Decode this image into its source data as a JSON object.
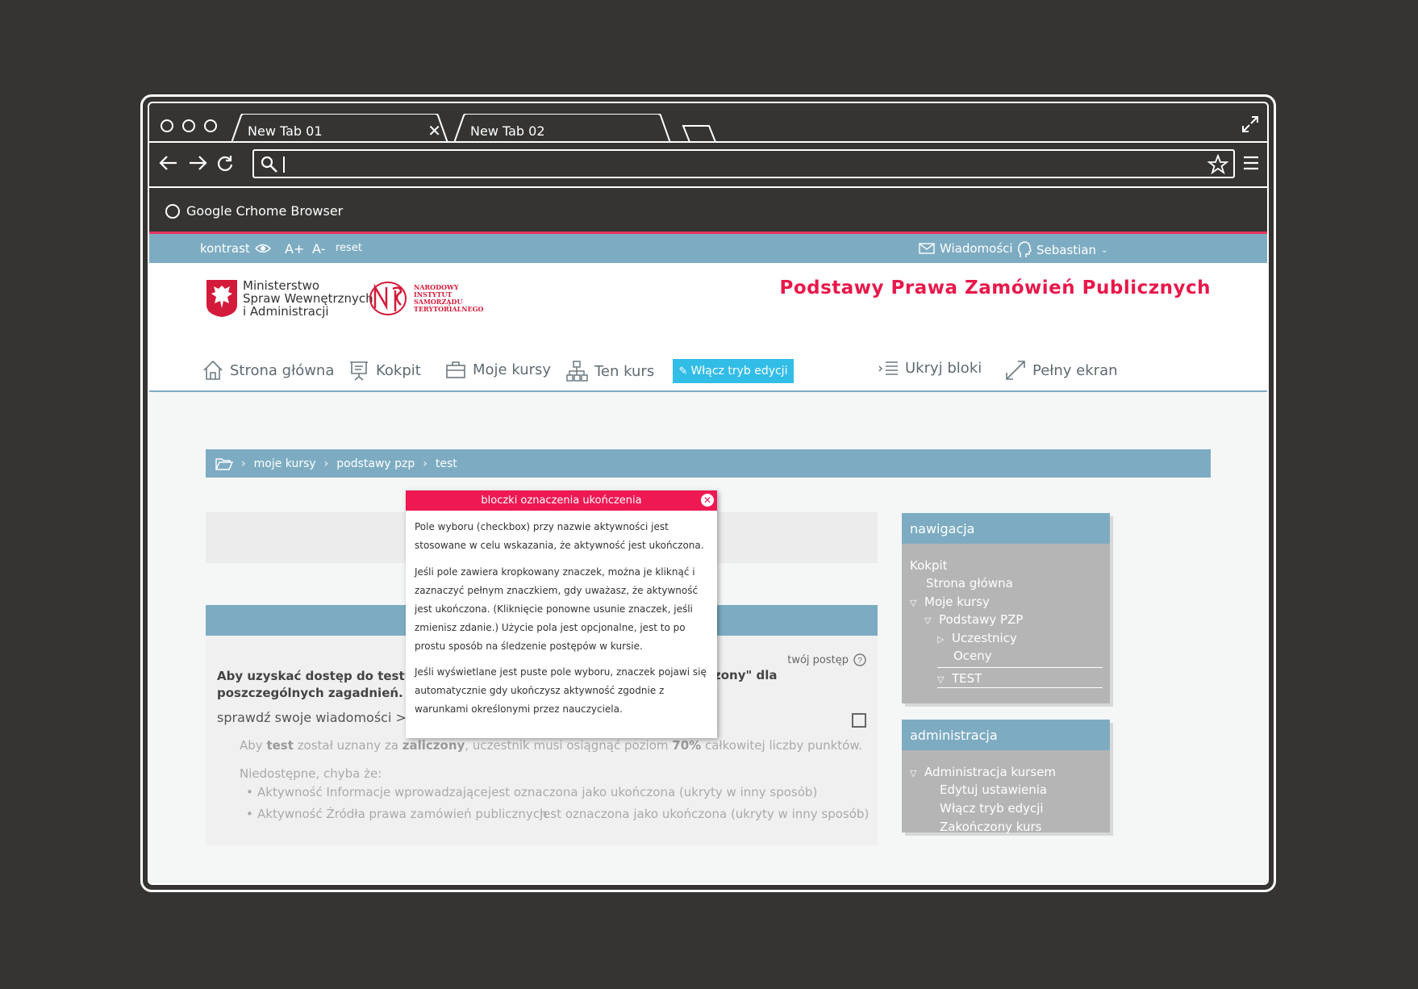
{
  "browser": {
    "tabs": [
      {
        "label": "New Tab 01",
        "close": "✕"
      },
      {
        "label": "New Tab 02"
      }
    ],
    "url": "",
    "bookmark": "Google Crhome Browser"
  },
  "topstrip": {
    "contrast": "kontrast",
    "font_plus": "A+",
    "font_minus": "A-",
    "reset": "reset",
    "messages": "Wiadomości",
    "user": "Sebastian"
  },
  "header": {
    "logo1_lines": [
      "Ministerstwo",
      "Spraw Wewnętrznych",
      "i Administracji"
    ],
    "logo2_lines": [
      "NARODOWY",
      "INSTYTUT",
      "SAMORZĄDU",
      "TERYTORIALNEGO"
    ],
    "title": "Podstawy Prawa Zamówień Publicznych"
  },
  "nav": {
    "home": "Strona główna",
    "dashboard": "Kokpit",
    "mycourses": "Moje kursy",
    "thiscourse": "Ten kurs",
    "edit": "Włącz tryb edycji",
    "hideblocks": "Ukryj bloki",
    "fullscreen": "Pełny ekran"
  },
  "breadcrumb": [
    "moje kursy",
    "podstawy pzp",
    "test"
  ],
  "content": {
    "progress_label": "twój postęp",
    "para_part1": "Aby uzyskać dostęp do testu należy",
    "para_part2": "poszczególnych zagadnień.",
    "para_right": "zony\" dla",
    "sprawdz": "sprawdź swoje wiadomości >>> t",
    "cond_prefix": "Aby",
    "cond_test": "test",
    "cond_mid": "został uznany za",
    "cond_zal": "zaliczony",
    "cond_mid2": ", uczestnik musi osiągnąć poziom",
    "cond_pct": "70%",
    "cond_suffix": "całkowitej liczby punktów.",
    "nied": "Niedostępne, chyba że:",
    "items": [
      {
        "activity": "Aktywność Informacje wprowadzające",
        "status": "jest oznaczona jako ukończona (ukryty w inny sposób)"
      },
      {
        "activity": "Aktywność Źródła prawa zamówień publicznych",
        "status": "jest oznaczona jako ukończona (ukryty w inny sposób)"
      }
    ]
  },
  "nav_block": {
    "title": "nawigacja",
    "items": [
      "Kokpit",
      "Strona główna",
      "Moje kursy",
      "Podstawy PZP",
      "Uczestnicy",
      "Oceny",
      "TEST"
    ]
  },
  "admin_block": {
    "title": "administracja",
    "items": [
      "Administracja kursem",
      "Edytuj ustawienia",
      "Włącz tryb edycji",
      "Zakończony kurs"
    ]
  },
  "modal": {
    "title": "bloczki oznaczenia ukończenia",
    "close": "✕",
    "p1": "Pole wyboru (checkbox) przy nazwie aktywności jest stosowane w celu wskazania, że aktywność jest ukończona.",
    "p2": "Jeśli pole zawiera kropkowany znaczek, można je kliknąć i zaznaczyć pełnym znaczkiem, gdy uważasz, że aktywność jest ukończona. (Kliknięcie ponowne usunie znaczek, jeśli zmienisz zdanie.) Użycie pola jest opcjonalne, jest to po prostu sposób na śledzenie postępów w kursie.",
    "p3": "Jeśli wyświetlane jest puste pole wyboru, znaczek pojawi się automatycznie gdy ukończysz aktywność zgodnie z warunkami określonymi przez nauczyciela."
  },
  "colors": {
    "accent_blue": "#7dacc2",
    "accent_pink": "#ee1853",
    "edit_button": "#32bde7"
  }
}
